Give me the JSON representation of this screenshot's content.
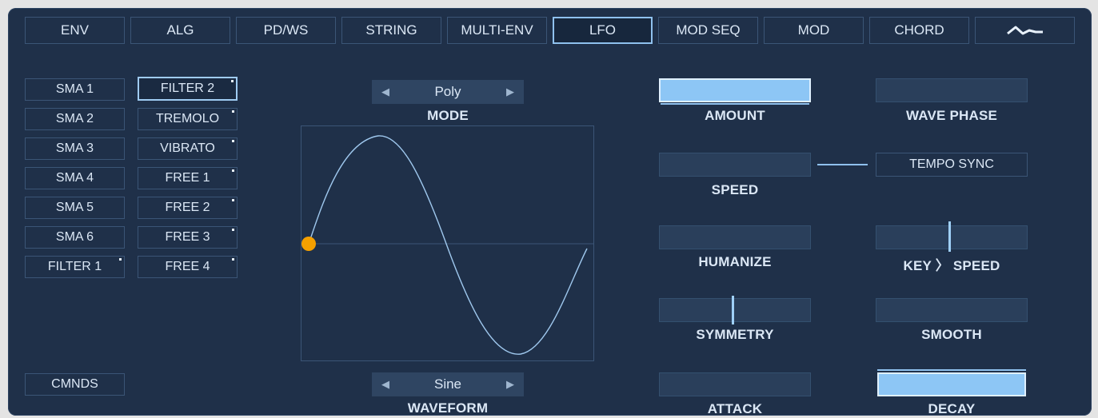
{
  "tabs": [
    "ENV",
    "ALG",
    "PD/WS",
    "STRING",
    "MULTI-ENV",
    "LFO",
    "MOD SEQ",
    "MOD",
    "CHORD"
  ],
  "active_tab": "LFO",
  "wave_tab_icon": "waveform-icon",
  "sources_left": [
    "SMA 1",
    "SMA 2",
    "SMA 3",
    "SMA 4",
    "SMA 5",
    "SMA 6",
    "FILTER 1"
  ],
  "sources_right": [
    "FILTER 2",
    "TREMOLO",
    "VIBRATO",
    "FREE 1",
    "FREE 2",
    "FREE 3",
    "FREE 4"
  ],
  "selected_source": "FILTER 2",
  "cmnds_label": "CMNDS",
  "mode": {
    "value": "Poly",
    "label": "MODE"
  },
  "waveform": {
    "value": "Sine",
    "label": "WAVEFORM"
  },
  "params": {
    "amount": "AMOUNT",
    "speed": "SPEED",
    "humanize": "HUMANIZE",
    "symmetry": "SYMMETRY",
    "attack": "ATTACK",
    "wave_phase": "WAVE PHASE",
    "tempo_sync": "TEMPO SYNC",
    "key_speed": "KEY 〉 SPEED",
    "smooth": "SMOOTH",
    "decay": "DECAY"
  },
  "colors": {
    "accent": "#8dc6f5",
    "panel": "#1f3049",
    "dot": "#f5a000"
  }
}
